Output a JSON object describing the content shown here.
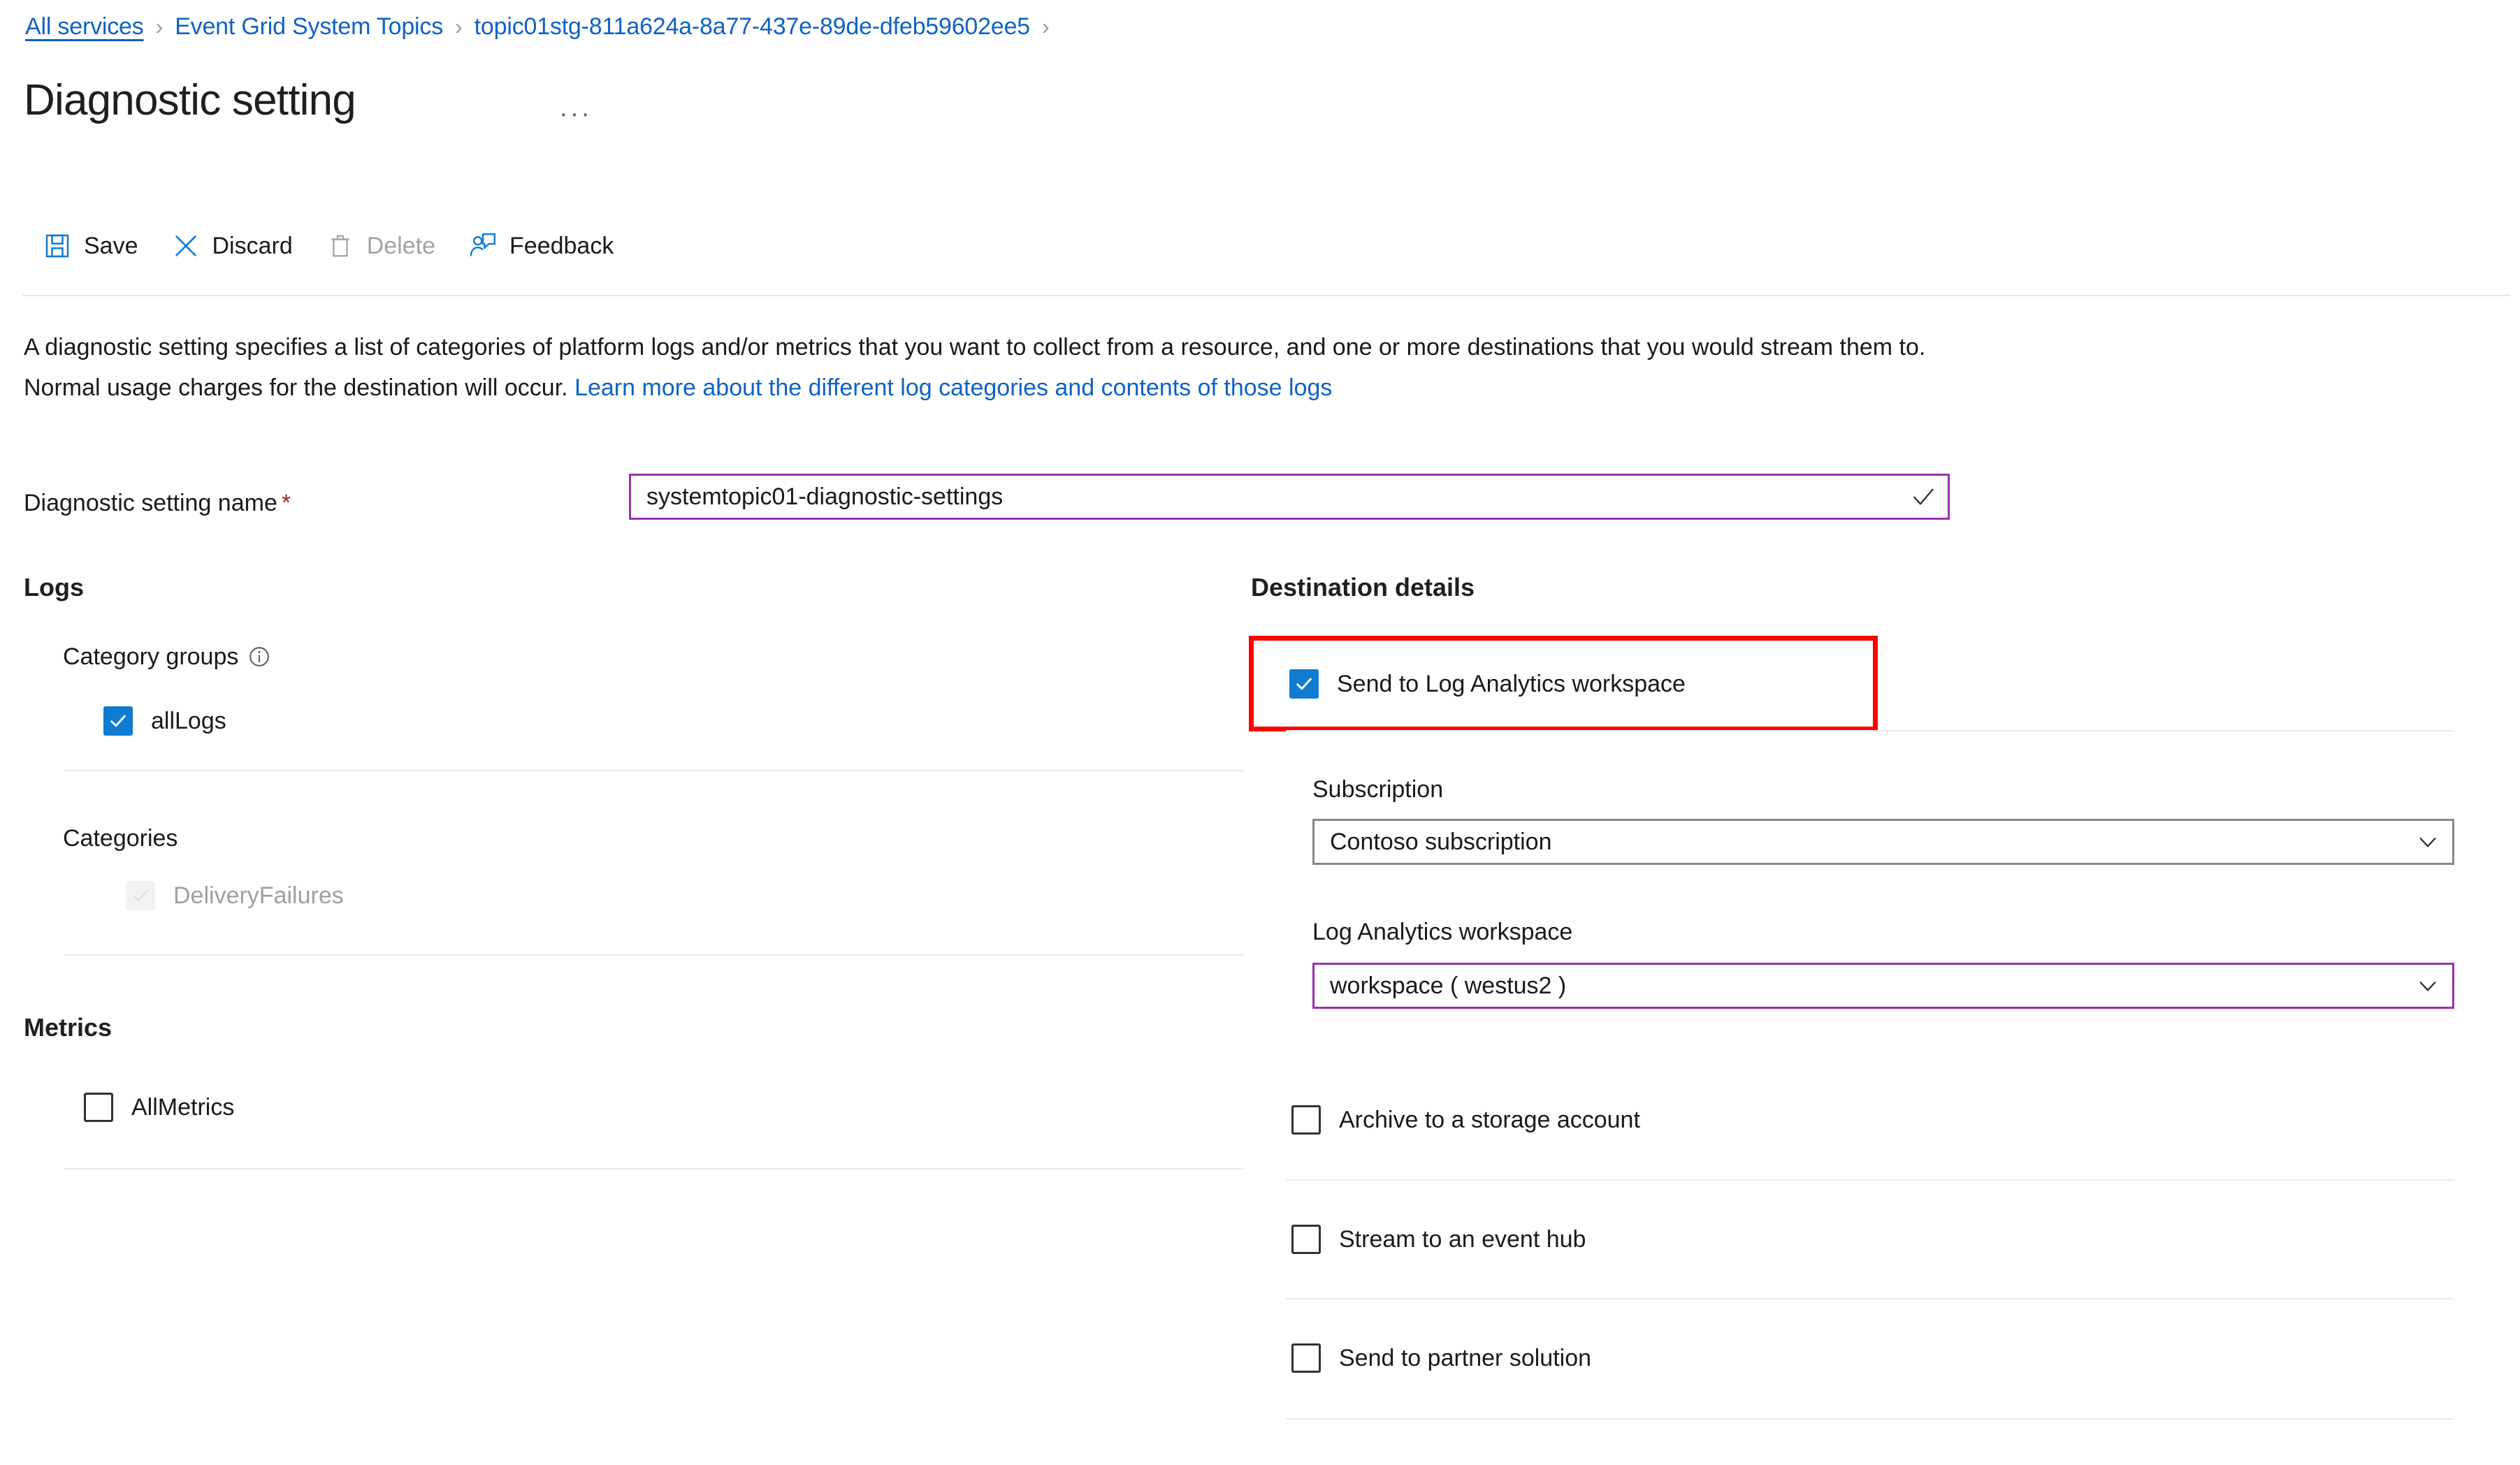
{
  "breadcrumb": {
    "separator": "›",
    "items": [
      {
        "label": "All services",
        "underlined": true
      },
      {
        "label": "Event Grid System Topics",
        "underlined": false
      },
      {
        "label": "topic01stg-811a624a-8a77-437e-89de-dfeb59602ee5",
        "underlined": false
      }
    ]
  },
  "header": {
    "title": "Diagnostic setting",
    "more_menu": "···"
  },
  "toolbar": {
    "items": [
      {
        "label": "Save",
        "icon": "save-icon",
        "disabled": false
      },
      {
        "label": "Discard",
        "icon": "discard-icon",
        "disabled": false
      },
      {
        "label": "Delete",
        "icon": "delete-icon",
        "disabled": true
      },
      {
        "label": "Feedback",
        "icon": "feedback-icon",
        "disabled": false
      }
    ]
  },
  "description": {
    "text_before": "A diagnostic setting specifies a list of categories of platform logs and/or metrics that you want to collect from a resource, and one or more destinations that you would stream them to. Normal usage charges for the destination will occur. ",
    "link_text": "Learn more about the different log categories and contents of those logs"
  },
  "name_field": {
    "label": "Diagnostic setting name",
    "required_marker": "*",
    "value": "systemtopic01-diagnostic-settings",
    "placeholder": "",
    "validation_icon": "checkmark-icon"
  },
  "logs": {
    "heading": "Logs",
    "category_groups_label": "Category groups",
    "info_icon": "info-icon",
    "category_groups": [
      {
        "label": "allLogs",
        "checked": true,
        "disabled": false
      }
    ],
    "categories_label": "Categories",
    "categories": [
      {
        "label": "DeliveryFailures",
        "checked": true,
        "disabled": true
      }
    ]
  },
  "metrics": {
    "heading": "Metrics",
    "items": [
      {
        "label": "AllMetrics",
        "checked": false,
        "disabled": false
      }
    ]
  },
  "destination": {
    "heading": "Destination details",
    "log_analytics": {
      "label": "Send to Log Analytics workspace",
      "checked": true,
      "highlighted": true,
      "highlight_color": "#ff0000"
    },
    "subscription": {
      "label": "Subscription",
      "value": "Contoso subscription",
      "chevron": "chevron-down-icon",
      "border": "grey"
    },
    "workspace": {
      "label": "Log Analytics workspace",
      "value": "workspace ( westus2 )",
      "chevron": "chevron-down-icon",
      "border": "purple"
    },
    "other_options": [
      {
        "label": "Archive to a storage account",
        "checked": false
      },
      {
        "label": "Stream to an event hub",
        "checked": false
      },
      {
        "label": "Send to partner solution",
        "checked": false
      }
    ]
  },
  "colors": {
    "link": "#0f62c4",
    "checkbox_checked": "#0f7bd1",
    "focus_border": "#9b30ad",
    "required_star": "#a4262c",
    "highlight": "#ff0000"
  }
}
